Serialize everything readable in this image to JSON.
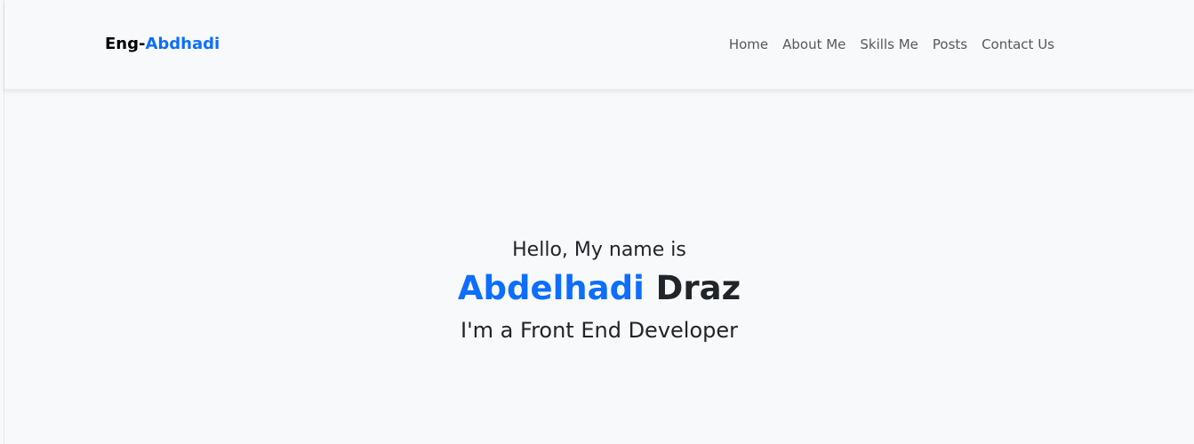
{
  "navbar": {
    "brand": {
      "prefix": "Eng-",
      "accent": "Abdhadi"
    },
    "links": [
      {
        "label": "Home"
      },
      {
        "label": "About Me"
      },
      {
        "label": "Skills Me"
      },
      {
        "label": "Posts"
      },
      {
        "label": "Contact Us"
      }
    ]
  },
  "hero": {
    "greeting": "Hello, My name is",
    "first_name": "Abdelhadi",
    "last_name": "Draz",
    "role": "I'm a Front End Developer"
  },
  "colors": {
    "accent": "#0d6efd",
    "text": "#212529",
    "background": "#f8f9fa",
    "nav_link": "#55595e"
  }
}
